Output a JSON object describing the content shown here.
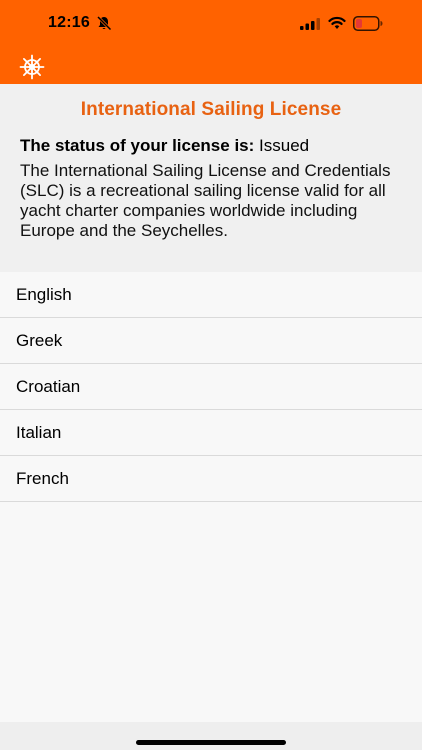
{
  "status_bar": {
    "time": "12:16",
    "icons": [
      "bell-slash-icon",
      "cellular-signal-icon",
      "wifi-icon",
      "battery-icon"
    ]
  },
  "navbar": {
    "icon": "ship-wheel-icon"
  },
  "intro": {
    "title": "International Sailing License",
    "status_label": "The status of your license is:",
    "status_value": "Issued",
    "description": "The International Sailing License and Credentials (SLC) is a recreational sailing license valid for all yacht charter companies worldwide including Europe and the Seychelles."
  },
  "languages": [
    "English",
    "Greek",
    "Croatian",
    "Italian",
    "French"
  ],
  "colors": {
    "brand_orange": "#ff6200",
    "title_orange": "#e86212",
    "battery_fill": "#e53935"
  }
}
